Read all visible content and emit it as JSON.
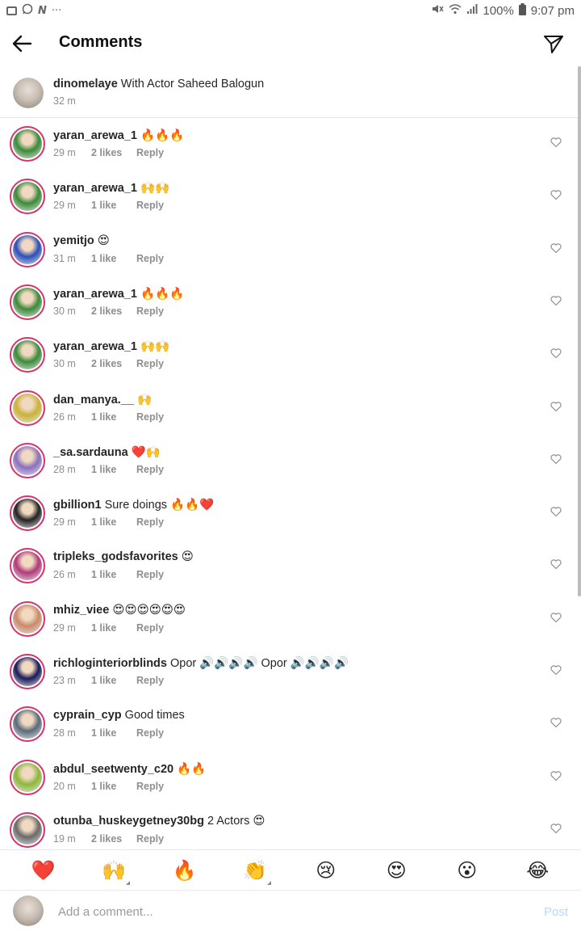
{
  "status_bar": {
    "left_icons": [
      "gallery-icon",
      "whatsapp-icon",
      "n-icon",
      "more-dots-icon"
    ],
    "n_glyph": "N",
    "dots": "···",
    "battery": "100%",
    "time": "9:07 pm"
  },
  "header": {
    "title": "Comments"
  },
  "caption": {
    "username": "dinomelaye",
    "text": " With Actor Saheed Balogun",
    "time": "32 m"
  },
  "comments": [
    {
      "username": "yaran_arewa_1",
      "text": " 🔥🔥🔥",
      "time": "29 m",
      "likes": "2 likes",
      "reply": "Reply",
      "avatar_color": "#3a8a3a"
    },
    {
      "username": "yaran_arewa_1",
      "text": " 🙌🙌",
      "time": "29 m",
      "likes": "1 like",
      "reply": "Reply",
      "avatar_color": "#3a8a3a"
    },
    {
      "username": "yemitjo",
      "text": " 😍",
      "time": "31 m",
      "likes": "1 like",
      "reply": "Reply",
      "avatar_color": "#2b4fb8"
    },
    {
      "username": "yaran_arewa_1",
      "text": " 🔥🔥🔥",
      "time": "30 m",
      "likes": "2 likes",
      "reply": "Reply",
      "avatar_color": "#3a8a3a"
    },
    {
      "username": "yaran_arewa_1",
      "text": " 🙌🙌",
      "time": "30 m",
      "likes": "2 likes",
      "reply": "Reply",
      "avatar_color": "#3a8a3a"
    },
    {
      "username": "dan_manya.__",
      "text": " 🙌",
      "time": "26 m",
      "likes": "1 like",
      "reply": "Reply",
      "avatar_color": "#c9b23a"
    },
    {
      "username": "_sa.sardauna",
      "text": " ❤️🙌",
      "time": "28 m",
      "likes": "1 like",
      "reply": "Reply",
      "avatar_color": "#8a6fc0"
    },
    {
      "username": "gbillion1",
      "text": " Sure doings 🔥🔥❤️",
      "time": "29 m",
      "likes": "1 like",
      "reply": "Reply",
      "avatar_color": "#222222"
    },
    {
      "username": "tripleks_godsfavorites",
      "text": " 😍",
      "time": "26 m",
      "likes": "1 like",
      "reply": "Reply",
      "avatar_color": "#b03a7a"
    },
    {
      "username": "mhiz_viee",
      "text": " 😍😍😍😍😍😍",
      "time": "29 m",
      "likes": "1 like",
      "reply": "Reply",
      "avatar_color": "#c98a6a"
    },
    {
      "username": "richloginteriorblinds",
      "text": " Opor 🔊🔊🔊🔊 Opor 🔊🔊🔊🔊",
      "time": "23 m",
      "likes": "1 like",
      "reply": "Reply",
      "avatar_color": "#1a1a5a"
    },
    {
      "username": "cyprain_cyp",
      "text": " Good times",
      "time": "28 m",
      "likes": "1 like",
      "reply": "Reply",
      "avatar_color": "#5a6a7a"
    },
    {
      "username": "abdul_seetwenty_c20",
      "text": " 🔥🔥",
      "time": "20 m",
      "likes": "1 like",
      "reply": "Reply",
      "avatar_color": "#8ab83a"
    },
    {
      "username": "otunba_huskeygetney30bg",
      "text": " 2 Actors 😍",
      "time": "19 m",
      "likes": "2 likes",
      "reply": "Reply",
      "avatar_color": "#6a6a6a"
    }
  ],
  "emoji_bar": [
    "❤️",
    "🙌",
    "🔥",
    "👏",
    "😢",
    "😍",
    "😮",
    "😂"
  ],
  "composer": {
    "placeholder": "Add a comment...",
    "post_label": "Post"
  },
  "colors": {
    "ring": "#d6336c",
    "post_disabled": "#b3dbff",
    "meta_text": "#8e8e8e"
  }
}
